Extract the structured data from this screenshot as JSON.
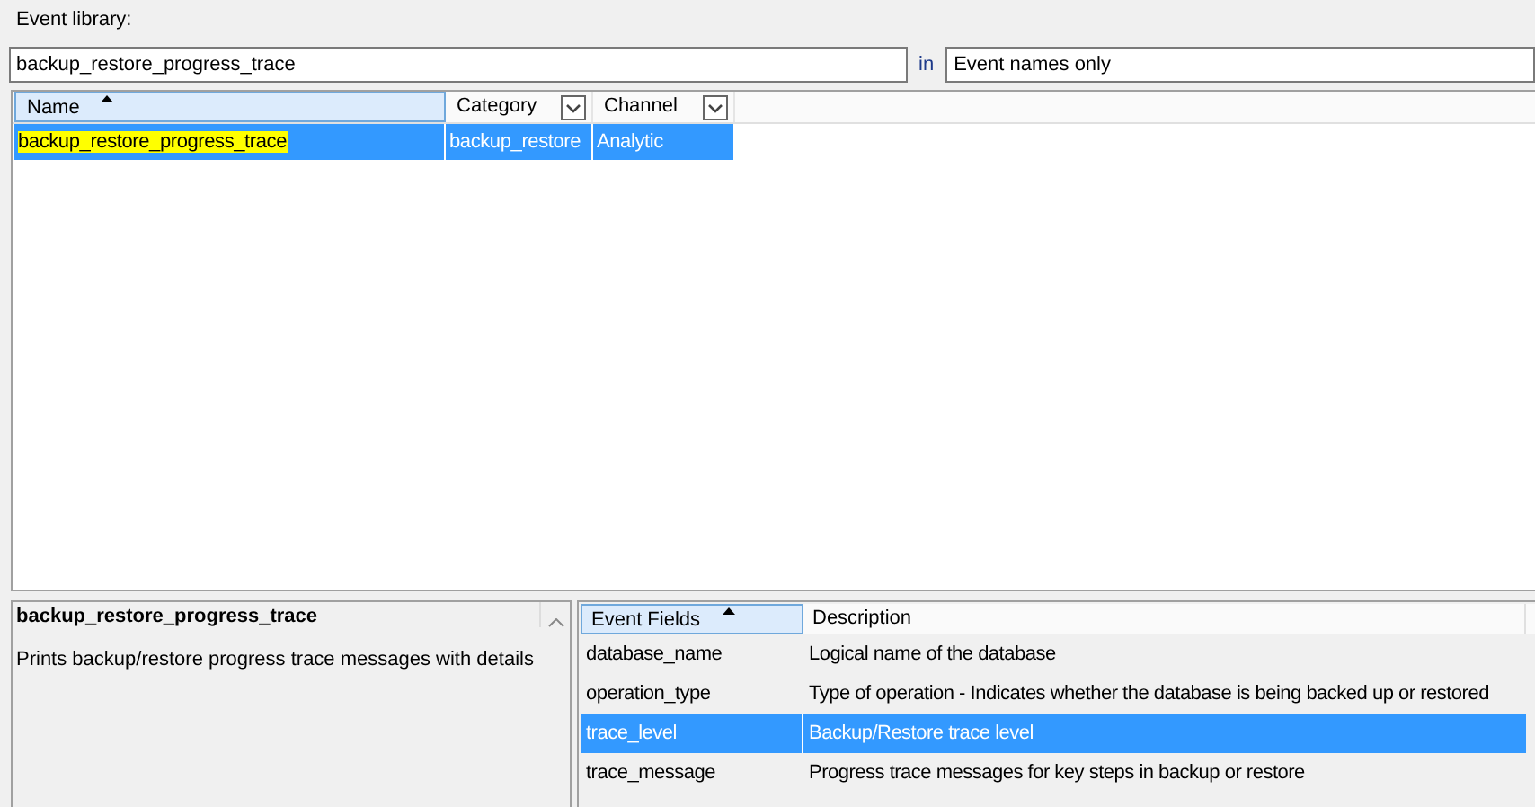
{
  "library_label": "Event library:",
  "search": {
    "value": "backup_restore_progress_trace"
  },
  "in_label": "in",
  "scope": {
    "value": "Event names only"
  },
  "events_table": {
    "columns": [
      {
        "label": "Name",
        "sorted": true,
        "filter": false
      },
      {
        "label": "Category",
        "sorted": false,
        "filter": true
      },
      {
        "label": "Channel",
        "sorted": false,
        "filter": true
      }
    ],
    "rows": [
      {
        "cells": [
          "backup_restore_progress_trace",
          "backup_restore",
          "Analytic"
        ],
        "selected": true,
        "match_highlighted": true
      }
    ]
  },
  "details": {
    "title": "backup_restore_progress_trace",
    "description": "Prints backup/restore progress trace messages with details"
  },
  "fields_table": {
    "columns": [
      {
        "label": "Event Fields",
        "sorted": true
      },
      {
        "label": "Description",
        "sorted": false
      }
    ],
    "rows": [
      {
        "cells": [
          "database_name",
          "Logical name of the database"
        ],
        "selected": false
      },
      {
        "cells": [
          "operation_type",
          "Type of operation - Indicates whether the database is being backed up or restored"
        ],
        "selected": false
      },
      {
        "cells": [
          "trace_level",
          "Backup/Restore trace level"
        ],
        "selected": true
      },
      {
        "cells": [
          "trace_message",
          "Progress trace messages for key steps in backup or restore"
        ],
        "selected": false
      }
    ]
  }
}
